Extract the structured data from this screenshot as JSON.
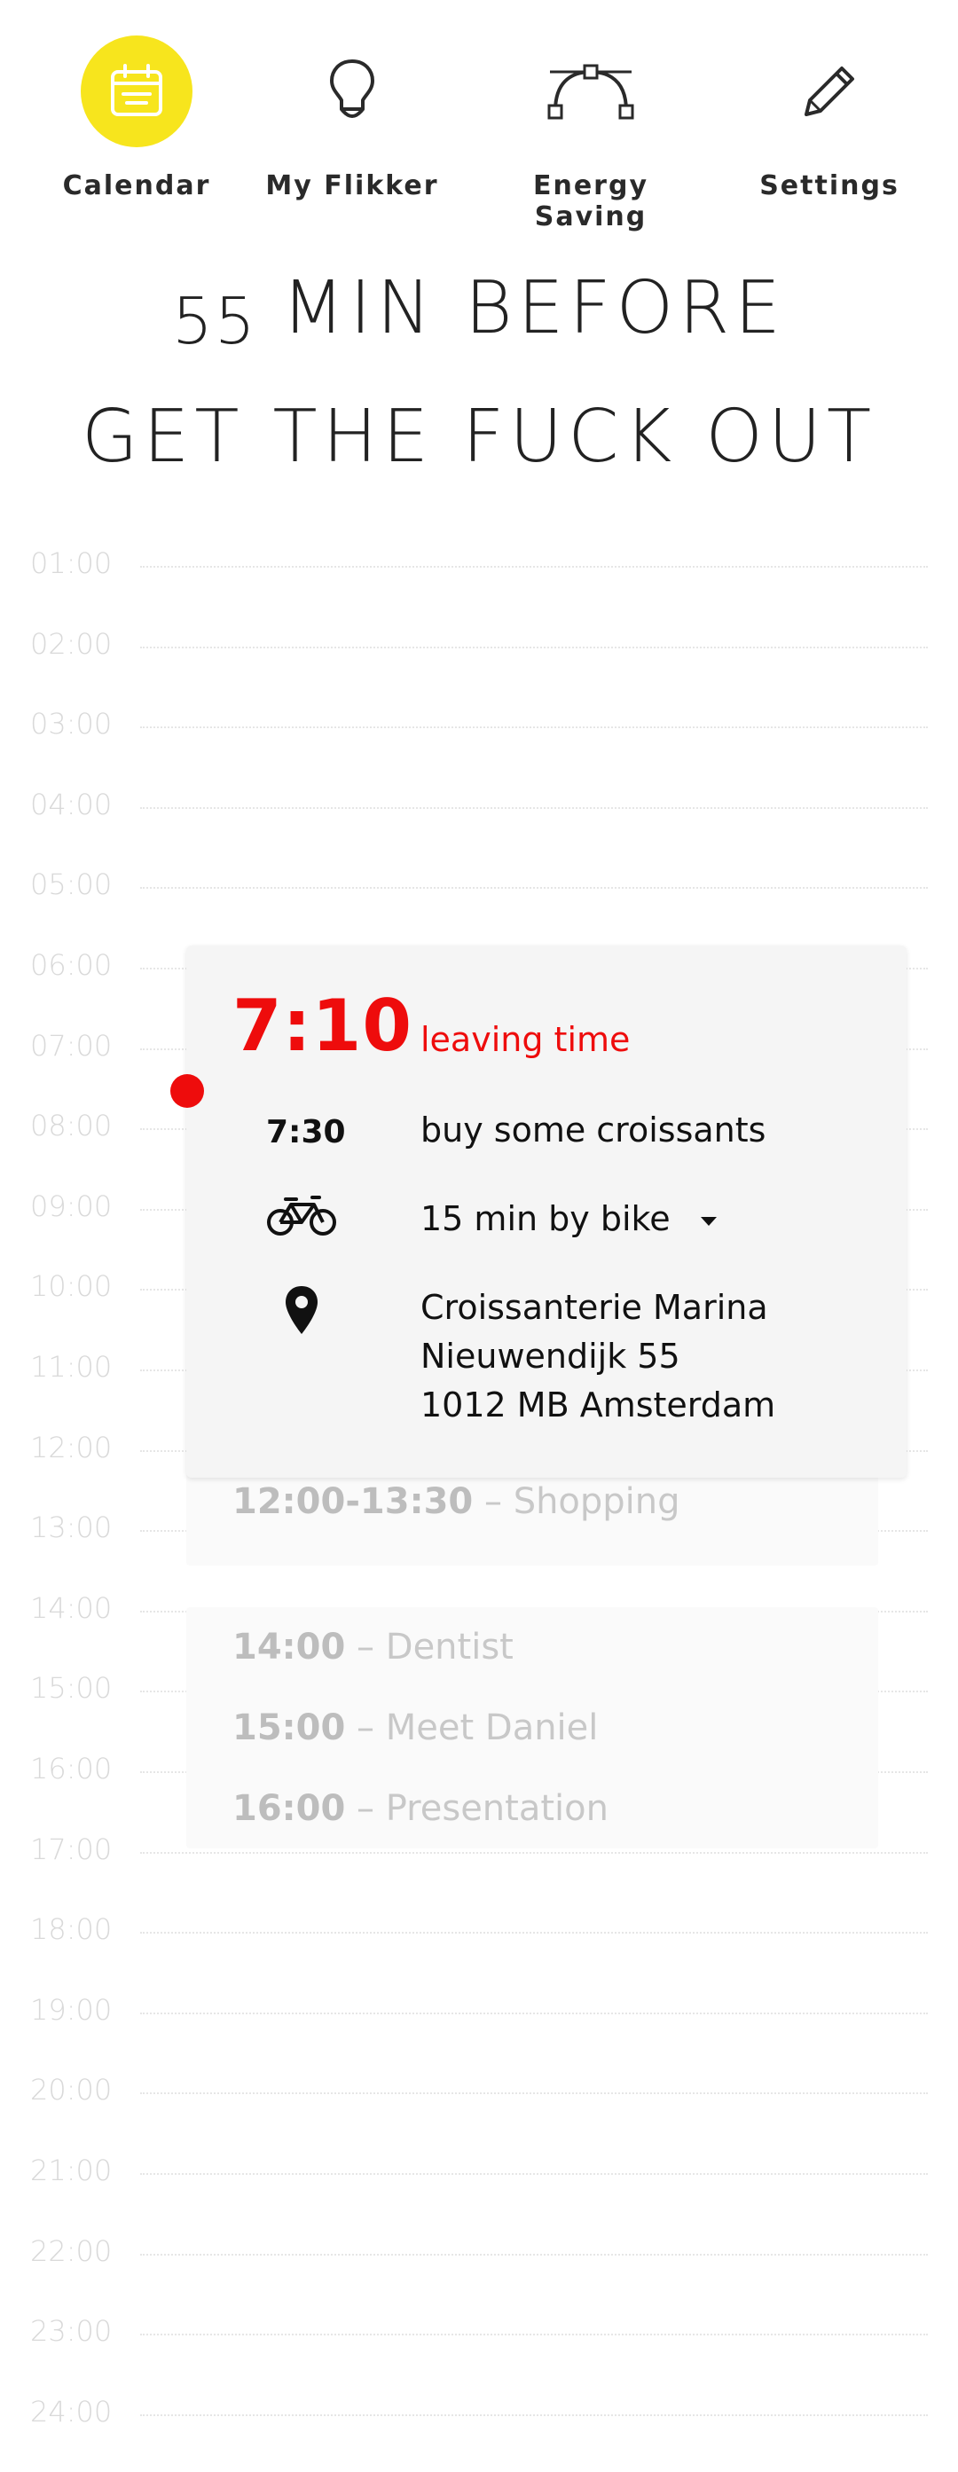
{
  "nav": {
    "items": [
      {
        "label": "Calendar",
        "icon": "calendar-icon",
        "active": true
      },
      {
        "label": "My Flikker",
        "icon": "lightbulb-icon",
        "active": false
      },
      {
        "label": "Energy Saving",
        "icon": "bezier-curve-icon",
        "active": false
      },
      {
        "label": "Settings",
        "icon": "pencil-icon",
        "active": false
      }
    ],
    "active_color": "#f7e51d"
  },
  "headline": {
    "count": "55",
    "line1": "MIN BEFORE",
    "line2": "GET THE FUCK OUT"
  },
  "hours": [
    "01:00",
    "02:00",
    "03:00",
    "04:00",
    "05:00",
    "06:00",
    "07:00",
    "08:00",
    "09:00",
    "10:00",
    "11:00",
    "12:00",
    "13:00",
    "14:00",
    "15:00",
    "16:00",
    "17:00",
    "18:00",
    "19:00",
    "20:00",
    "21:00",
    "22:00",
    "23:00",
    "24:00"
  ],
  "card": {
    "leave_time": "7:10",
    "leave_label": "leaving time",
    "event_time": "7:30",
    "event_title": "buy some croissants",
    "travel": "15 min by bike",
    "address": [
      "Croissanterie Marina",
      "Nieuwendijk 55",
      "1012 MB Amsterdam"
    ],
    "accent_color": "#ee0c0c"
  },
  "events": [
    {
      "time": "12:00-13:30",
      "sep": " – ",
      "title": "Shopping"
    },
    {
      "time": "14:00",
      "sep": " – ",
      "title": "Dentist"
    },
    {
      "time": "15:00",
      "sep": " – ",
      "title": "Meet Daniel"
    },
    {
      "time": "16:00",
      "sep": " – ",
      "title": "Presentation"
    }
  ]
}
